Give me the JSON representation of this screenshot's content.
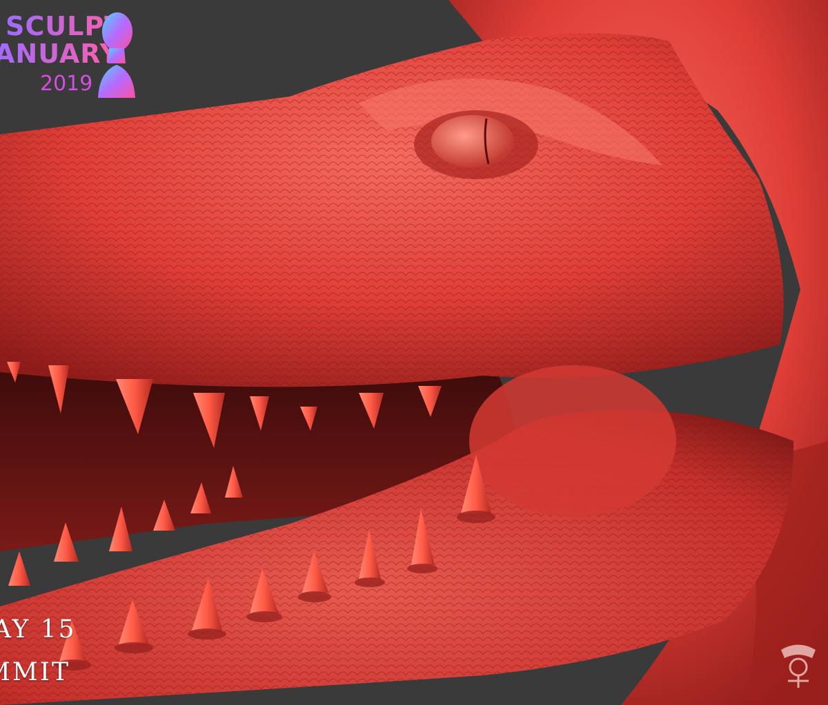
{
  "logo": {
    "line1": "SCULPT",
    "line2": "ANUARY",
    "year": "2019"
  },
  "caption": {
    "day": "AY 15",
    "name": "MMIT"
  },
  "colors": {
    "background": "#3a3a3a",
    "skin": "#e0453e",
    "skin_dark": "#8e1c1a",
    "tooth": "#ff6a55",
    "caption_text": "#ffffff"
  },
  "icons": {
    "logo_bust": "classical-bust-icon",
    "artist_signature": "samurai-mon-icon"
  }
}
